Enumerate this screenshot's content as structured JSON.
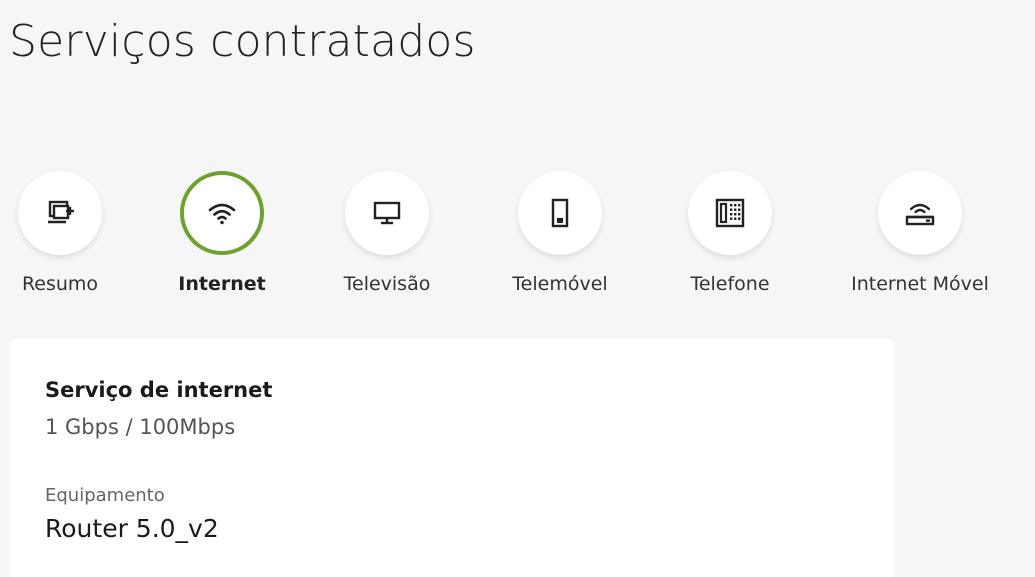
{
  "page": {
    "title": "Serviços contratados"
  },
  "tabs": [
    {
      "label": "Resumo",
      "icon": "summary-icon",
      "active": false
    },
    {
      "label": "Internet",
      "icon": "wifi-icon",
      "active": true
    },
    {
      "label": "Televisão",
      "icon": "tv-icon",
      "active": false
    },
    {
      "label": "Telemóvel",
      "icon": "mobile-phone-icon",
      "active": false
    },
    {
      "label": "Telefone",
      "icon": "landline-phone-icon",
      "active": false
    },
    {
      "label": "Internet Móvel",
      "icon": "mobile-router-icon",
      "active": false
    }
  ],
  "card": {
    "service_title": "Serviço de internet",
    "service_speed": "1 Gbps / 100Mbps",
    "equipment_label": "Equipamento",
    "equipment_value": "Router 5.0_v2"
  },
  "colors": {
    "accent": "#6ea12d",
    "background": "#f6f6f6",
    "card": "#ffffff"
  }
}
